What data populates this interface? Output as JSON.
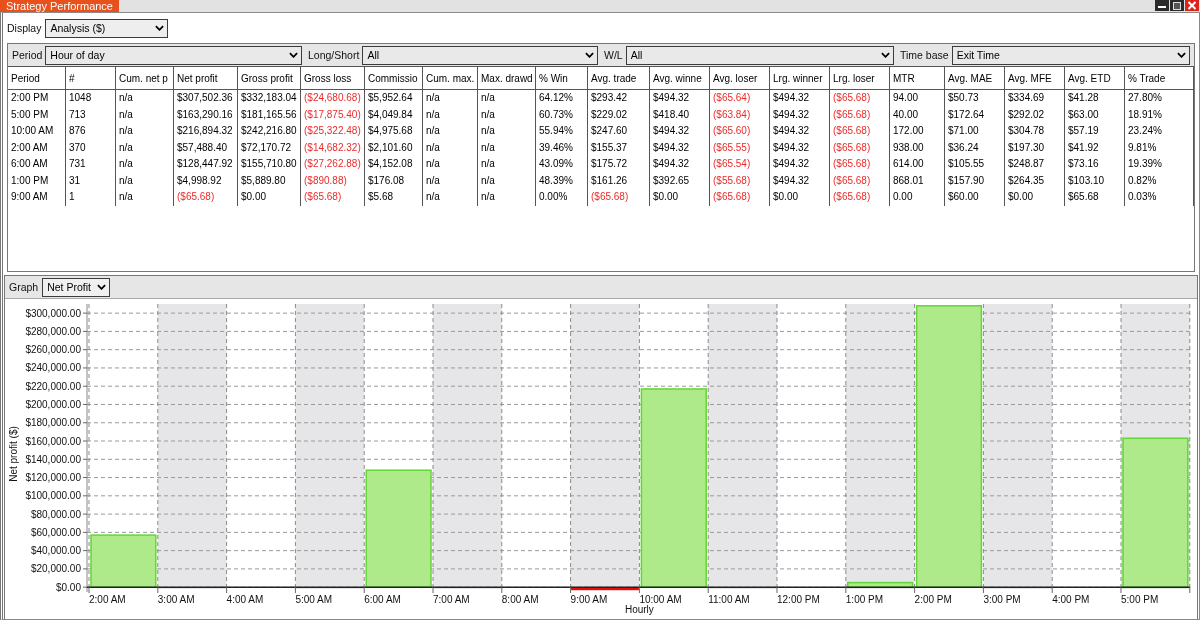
{
  "window": {
    "title": "Strategy Performance"
  },
  "display": {
    "label": "Display",
    "value": "Analysis ($)"
  },
  "filters": [
    {
      "label": "Period",
      "value": "Hour of day"
    },
    {
      "label": "Long/Short",
      "value": "All"
    },
    {
      "label": "W/L",
      "value": "All"
    },
    {
      "label": "Time base",
      "value": "Exit Time"
    }
  ],
  "table": {
    "columns": [
      "Period",
      "#",
      "Cum. net p",
      "Net profit",
      "Gross profit",
      "Gross loss",
      "Commissio",
      "Cum. max.",
      "Max. drawd",
      "% Win",
      "Avg. trade",
      "Avg. winne",
      "Avg. loser",
      "Lrg. winner",
      "Lrg. loser",
      "MTR",
      "Avg. MAE",
      "Avg. MFE",
      "Avg. ETD",
      "% Trade"
    ],
    "rows": [
      {
        "cells": [
          {
            "text": "2:00 PM",
            "negative": false
          },
          {
            "text": "1048",
            "negative": false
          },
          {
            "text": "n/a",
            "negative": false
          },
          {
            "text": "$307,502.36",
            "negative": false
          },
          {
            "text": "$332,183.04",
            "negative": false
          },
          {
            "text": "($24,680.68)",
            "negative": true
          },
          {
            "text": "$5,952.64",
            "negative": false
          },
          {
            "text": "n/a",
            "negative": false
          },
          {
            "text": "n/a",
            "negative": false
          },
          {
            "text": "64.12%",
            "negative": false
          },
          {
            "text": "$293.42",
            "negative": false
          },
          {
            "text": "$494.32",
            "negative": false
          },
          {
            "text": "($65.64)",
            "negative": true
          },
          {
            "text": "$494.32",
            "negative": false
          },
          {
            "text": "($65.68)",
            "negative": true
          },
          {
            "text": "94.00",
            "negative": false
          },
          {
            "text": "$50.73",
            "negative": false
          },
          {
            "text": "$334.69",
            "negative": false
          },
          {
            "text": "$41.28",
            "negative": false
          },
          {
            "text": "27.80%",
            "negative": false
          }
        ]
      },
      {
        "cells": [
          {
            "text": "5:00 PM",
            "negative": false
          },
          {
            "text": "713",
            "negative": false
          },
          {
            "text": "n/a",
            "negative": false
          },
          {
            "text": "$163,290.16",
            "negative": false
          },
          {
            "text": "$181,165.56",
            "negative": false
          },
          {
            "text": "($17,875.40)",
            "negative": true
          },
          {
            "text": "$4,049.84",
            "negative": false
          },
          {
            "text": "n/a",
            "negative": false
          },
          {
            "text": "n/a",
            "negative": false
          },
          {
            "text": "60.73%",
            "negative": false
          },
          {
            "text": "$229.02",
            "negative": false
          },
          {
            "text": "$418.40",
            "negative": false
          },
          {
            "text": "($63.84)",
            "negative": true
          },
          {
            "text": "$494.32",
            "negative": false
          },
          {
            "text": "($65.68)",
            "negative": true
          },
          {
            "text": "40.00",
            "negative": false
          },
          {
            "text": "$172.64",
            "negative": false
          },
          {
            "text": "$292.02",
            "negative": false
          },
          {
            "text": "$63.00",
            "negative": false
          },
          {
            "text": "18.91%",
            "negative": false
          }
        ]
      },
      {
        "cells": [
          {
            "text": "10:00 AM",
            "negative": false
          },
          {
            "text": "876",
            "negative": false
          },
          {
            "text": "n/a",
            "negative": false
          },
          {
            "text": "$216,894.32",
            "negative": false
          },
          {
            "text": "$242,216.80",
            "negative": false
          },
          {
            "text": "($25,322.48)",
            "negative": true
          },
          {
            "text": "$4,975.68",
            "negative": false
          },
          {
            "text": "n/a",
            "negative": false
          },
          {
            "text": "n/a",
            "negative": false
          },
          {
            "text": "55.94%",
            "negative": false
          },
          {
            "text": "$247.60",
            "negative": false
          },
          {
            "text": "$494.32",
            "negative": false
          },
          {
            "text": "($65.60)",
            "negative": true
          },
          {
            "text": "$494.32",
            "negative": false
          },
          {
            "text": "($65.68)",
            "negative": true
          },
          {
            "text": "172.00",
            "negative": false
          },
          {
            "text": "$71.00",
            "negative": false
          },
          {
            "text": "$304.78",
            "negative": false
          },
          {
            "text": "$57.19",
            "negative": false
          },
          {
            "text": "23.24%",
            "negative": false
          }
        ]
      },
      {
        "cells": [
          {
            "text": "2:00 AM",
            "negative": false
          },
          {
            "text": "370",
            "negative": false
          },
          {
            "text": "n/a",
            "negative": false
          },
          {
            "text": "$57,488.40",
            "negative": false
          },
          {
            "text": "$72,170.72",
            "negative": false
          },
          {
            "text": "($14,682.32)",
            "negative": true
          },
          {
            "text": "$2,101.60",
            "negative": false
          },
          {
            "text": "n/a",
            "negative": false
          },
          {
            "text": "n/a",
            "negative": false
          },
          {
            "text": "39.46%",
            "negative": false
          },
          {
            "text": "$155.37",
            "negative": false
          },
          {
            "text": "$494.32",
            "negative": false
          },
          {
            "text": "($65.55)",
            "negative": true
          },
          {
            "text": "$494.32",
            "negative": false
          },
          {
            "text": "($65.68)",
            "negative": true
          },
          {
            "text": "938.00",
            "negative": false
          },
          {
            "text": "$36.24",
            "negative": false
          },
          {
            "text": "$197.30",
            "negative": false
          },
          {
            "text": "$41.92",
            "negative": false
          },
          {
            "text": "9.81%",
            "negative": false
          }
        ]
      },
      {
        "cells": [
          {
            "text": "6:00 AM",
            "negative": false
          },
          {
            "text": "731",
            "negative": false
          },
          {
            "text": "n/a",
            "negative": false
          },
          {
            "text": "$128,447.92",
            "negative": false
          },
          {
            "text": "$155,710.80",
            "negative": false
          },
          {
            "text": "($27,262.88)",
            "negative": true
          },
          {
            "text": "$4,152.08",
            "negative": false
          },
          {
            "text": "n/a",
            "negative": false
          },
          {
            "text": "n/a",
            "negative": false
          },
          {
            "text": "43.09%",
            "negative": false
          },
          {
            "text": "$175.72",
            "negative": false
          },
          {
            "text": "$494.32",
            "negative": false
          },
          {
            "text": "($65.54)",
            "negative": true
          },
          {
            "text": "$494.32",
            "negative": false
          },
          {
            "text": "($65.68)",
            "negative": true
          },
          {
            "text": "614.00",
            "negative": false
          },
          {
            "text": "$105.55",
            "negative": false
          },
          {
            "text": "$248.87",
            "negative": false
          },
          {
            "text": "$73.16",
            "negative": false
          },
          {
            "text": "19.39%",
            "negative": false
          }
        ]
      },
      {
        "cells": [
          {
            "text": "1:00 PM",
            "negative": false
          },
          {
            "text": "31",
            "negative": false
          },
          {
            "text": "n/a",
            "negative": false
          },
          {
            "text": "$4,998.92",
            "negative": false
          },
          {
            "text": "$5,889.80",
            "negative": false
          },
          {
            "text": "($890.88)",
            "negative": true
          },
          {
            "text": "$176.08",
            "negative": false
          },
          {
            "text": "n/a",
            "negative": false
          },
          {
            "text": "n/a",
            "negative": false
          },
          {
            "text": "48.39%",
            "negative": false
          },
          {
            "text": "$161.26",
            "negative": false
          },
          {
            "text": "$392.65",
            "negative": false
          },
          {
            "text": "($55.68)",
            "negative": true
          },
          {
            "text": "$494.32",
            "negative": false
          },
          {
            "text": "($65.68)",
            "negative": true
          },
          {
            "text": "868.01",
            "negative": false
          },
          {
            "text": "$157.90",
            "negative": false
          },
          {
            "text": "$264.35",
            "negative": false
          },
          {
            "text": "$103.10",
            "negative": false
          },
          {
            "text": "0.82%",
            "negative": false
          }
        ]
      },
      {
        "cells": [
          {
            "text": "9:00 AM",
            "negative": false
          },
          {
            "text": "1",
            "negative": false
          },
          {
            "text": "n/a",
            "negative": false
          },
          {
            "text": "($65.68)",
            "negative": true
          },
          {
            "text": "$0.00",
            "negative": false
          },
          {
            "text": "($65.68)",
            "negative": true
          },
          {
            "text": "$5.68",
            "negative": false
          },
          {
            "text": "n/a",
            "negative": false
          },
          {
            "text": "n/a",
            "negative": false
          },
          {
            "text": "0.00%",
            "negative": false
          },
          {
            "text": "($65.68)",
            "negative": true
          },
          {
            "text": "$0.00",
            "negative": false
          },
          {
            "text": "($65.68)",
            "negative": true
          },
          {
            "text": "$0.00",
            "negative": false
          },
          {
            "text": "($65.68)",
            "negative": true
          },
          {
            "text": "0.00",
            "negative": false
          },
          {
            "text": "$60.00",
            "negative": false
          },
          {
            "text": "$0.00",
            "negative": false
          },
          {
            "text": "$65.68",
            "negative": false
          },
          {
            "text": "0.03%",
            "negative": false
          }
        ]
      }
    ]
  },
  "graph": {
    "label": "Graph",
    "value": "Net Profit",
    "chart_data": {
      "type": "bar",
      "xlabel": "Hourly",
      "ylabel": "Net profit ($)",
      "categories": [
        "2:00 AM",
        "3:00 AM",
        "4:00 AM",
        "5:00 AM",
        "6:00 AM",
        "7:00 AM",
        "8:00 AM",
        "9:00 AM",
        "10:00 AM",
        "11:00 AM",
        "12:00 PM",
        "1:00 PM",
        "2:00 PM",
        "3:00 PM",
        "4:00 PM",
        "5:00 PM"
      ],
      "series": [
        {
          "color": "#aeea8a",
          "values": [
            57000,
            null,
            null,
            null,
            128000,
            null,
            null,
            null,
            217000,
            null,
            null,
            5000,
            308000,
            null,
            null,
            163000
          ]
        },
        {
          "color": "#e01010",
          "values": [
            null,
            null,
            null,
            null,
            null,
            null,
            null,
            -66,
            null,
            null,
            null,
            null,
            null,
            null,
            null,
            null
          ]
        }
      ],
      "stacked": true,
      "grid": true,
      "bands": [
        {
          "axis": "x",
          "from": "3:00 AM",
          "to": "4:00 AM",
          "color": "#e6e6e8"
        },
        {
          "axis": "x",
          "from": "5:00 AM",
          "to": "6:00 AM",
          "color": "#e6e6e8"
        },
        {
          "axis": "x",
          "from": "7:00 AM",
          "to": "8:00 AM",
          "color": "#e6e6e8"
        },
        {
          "axis": "x",
          "from": "9:00 AM",
          "to": "10:00 AM",
          "color": "#e6e6e8"
        },
        {
          "axis": "x",
          "from": "11:00 AM",
          "to": "12:00 PM",
          "color": "#e6e6e8"
        },
        {
          "axis": "x",
          "from": "1:00 PM",
          "to": "2:00 PM",
          "color": "#e6e6e8"
        },
        {
          "axis": "x",
          "from": "3:00 PM",
          "to": "4:00 PM",
          "color": "#e6e6e8"
        }
      ],
      "ylim": [
        -2000,
        310000
      ],
      "yticks": [
        {
          "value": 0,
          "label": "$0.00"
        },
        {
          "value": 20000,
          "label": "$20,000.00"
        },
        {
          "value": 40000,
          "label": "$40,000.00"
        },
        {
          "value": 60000,
          "label": "$60,000.00"
        },
        {
          "value": 80000,
          "label": "$80,000.00"
        },
        {
          "value": 100000,
          "label": "$100,000.00"
        },
        {
          "value": 120000,
          "label": "$120,000.00"
        },
        {
          "value": 140000,
          "label": "$140,000.00"
        },
        {
          "value": 160000,
          "label": "$160,000.00"
        },
        {
          "value": 180000,
          "label": "$180,000.00"
        },
        {
          "value": 200000,
          "label": "$200,000.00"
        },
        {
          "value": 220000,
          "label": "$220,000.00"
        },
        {
          "value": 240000,
          "label": "$240,000.00"
        },
        {
          "value": 260000,
          "label": "$260,000.00"
        },
        {
          "value": 280000,
          "label": "$280,000.00"
        },
        {
          "value": 300000,
          "label": "$300,000.00"
        }
      ]
    }
  }
}
